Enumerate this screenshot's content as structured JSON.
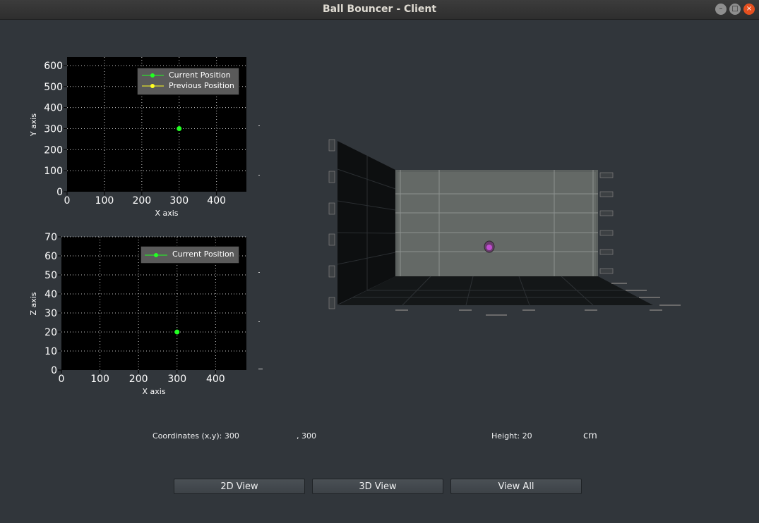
{
  "window": {
    "title": "Ball Bouncer - Client"
  },
  "xy_plot": {
    "xlabel": "X axis",
    "ylabel": "Y axis",
    "xticks": [
      "0",
      "100",
      "200",
      "300",
      "400"
    ],
    "yticks": [
      "0",
      "100",
      "200",
      "300",
      "400",
      "500",
      "600"
    ],
    "legend": [
      "Current Position",
      "Previous Position"
    ]
  },
  "xz_plot": {
    "xlabel": "X axis",
    "ylabel": "Z axis",
    "xticks": [
      "0",
      "100",
      "200",
      "300",
      "400"
    ],
    "yticks": [
      "0",
      "10",
      "20",
      "30",
      "40",
      "50",
      "60",
      "70"
    ],
    "legend": [
      "Current Position"
    ]
  },
  "chart_data": [
    {
      "type": "scatter",
      "xlabel": "X axis",
      "ylabel": "Y axis",
      "xlim": [
        0,
        480
      ],
      "ylim": [
        0,
        640
      ],
      "grid": true,
      "legend_position": "top-right",
      "series": [
        {
          "name": "Current Position",
          "color": "#22ff22",
          "points": [
            [
              300,
              300
            ]
          ]
        },
        {
          "name": "Previous Position",
          "color": "#ffff22",
          "points": []
        }
      ]
    },
    {
      "type": "scatter",
      "xlabel": "X axis",
      "ylabel": "Z axis",
      "xlim": [
        0,
        480
      ],
      "ylim": [
        0,
        70
      ],
      "grid": true,
      "legend_position": "top-right",
      "series": [
        {
          "name": "Current Position",
          "color": "#22ff22",
          "points": [
            [
              300,
              20
            ]
          ]
        }
      ]
    }
  ],
  "view3d": {
    "ball_color": "#c04ed1"
  },
  "status": {
    "coords_label": "Coordinates (x,y): 300",
    "coords_y": ", 300",
    "height_label": "Height: 20",
    "height_unit": "cm"
  },
  "buttons": {
    "view2d": "2D View",
    "view3d": "3D View",
    "view_all": "View All"
  },
  "colors": {
    "background": "#31363b",
    "plot_bg": "#000000",
    "accent_current": "#22ff22",
    "accent_previous": "#ffff22"
  }
}
